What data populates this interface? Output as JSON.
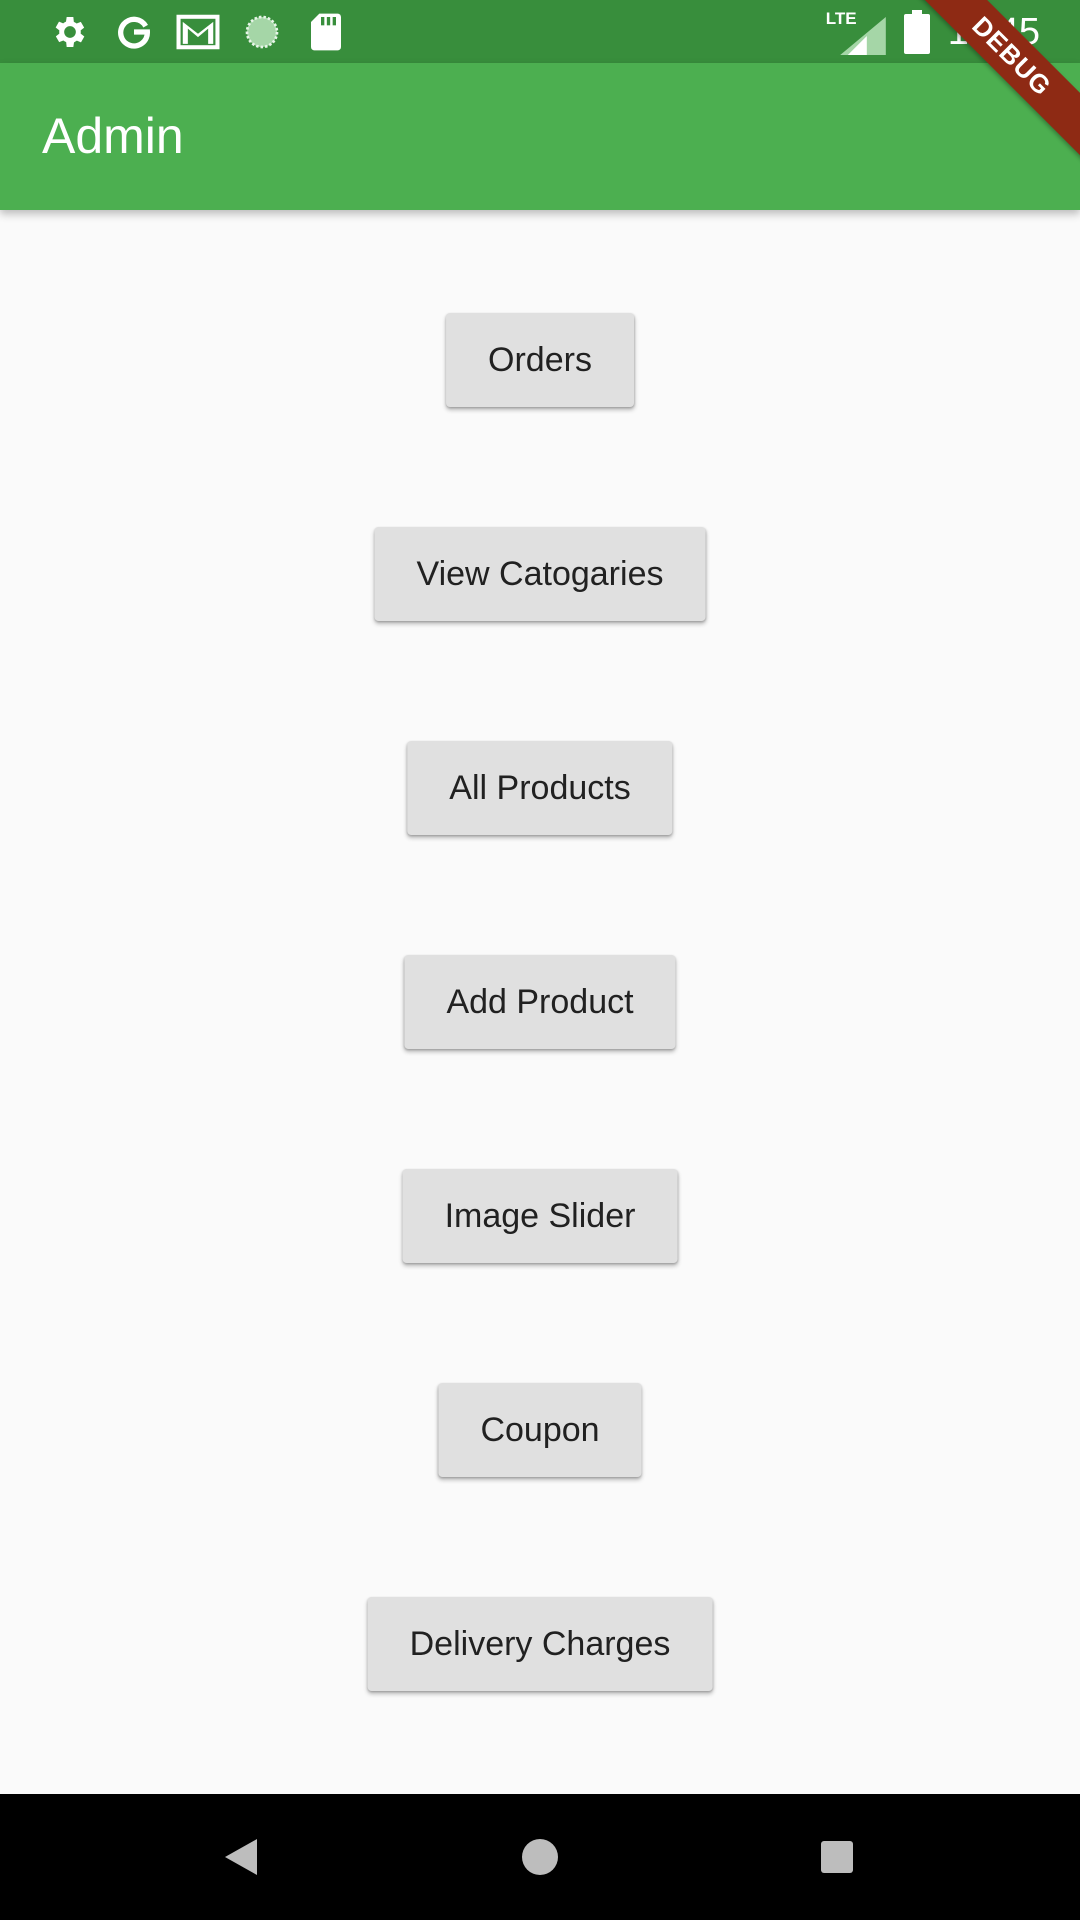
{
  "status_bar": {
    "time": "11:45",
    "network_label": "LTE",
    "icons_left": [
      "settings-icon",
      "google-icon",
      "gmail-icon",
      "sync-icon",
      "sd-card-icon"
    ],
    "icons_right": [
      "lte-signal-icon",
      "battery-icon"
    ],
    "color": "#388e3c"
  },
  "app_bar": {
    "title": "Admin",
    "color": "#4caf50"
  },
  "debug_banner": {
    "label": "DEBUG",
    "color": "#8e2a14"
  },
  "buttons": [
    {
      "label": "Orders"
    },
    {
      "label": "View Catogaries"
    },
    {
      "label": "All Products"
    },
    {
      "label": "Add Product"
    },
    {
      "label": "Image Slider"
    },
    {
      "label": "Coupon"
    },
    {
      "label": "Delivery Charges"
    }
  ],
  "nav_bar": {
    "items": [
      "back-icon",
      "home-icon",
      "recents-icon"
    ]
  }
}
